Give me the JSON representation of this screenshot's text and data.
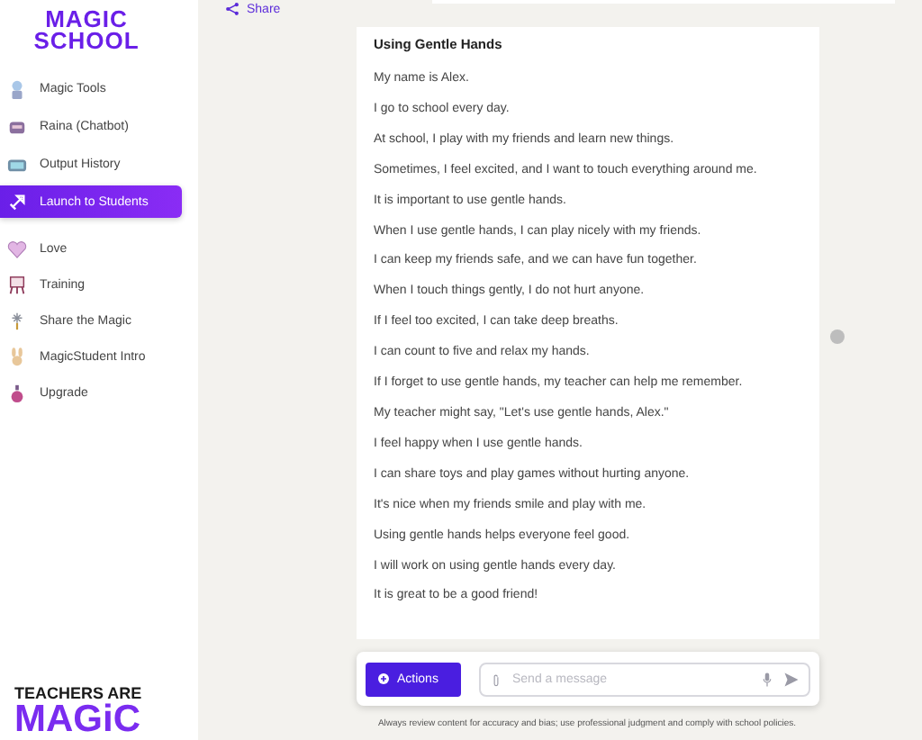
{
  "sidebar": {
    "logo": [
      "MAGIC",
      "SCHOOL"
    ],
    "items": [
      {
        "label": "Magic Tools",
        "selected": false
      },
      {
        "label": "Raina (Chatbot)",
        "selected": false
      },
      {
        "label": "Output History",
        "selected": false
      },
      {
        "label": "Launch to Students",
        "selected": true
      }
    ],
    "extra_items": [
      {
        "label": "Love"
      },
      {
        "label": "Training"
      },
      {
        "label": "Share the Magic"
      },
      {
        "label": "MagicStudent Intro"
      },
      {
        "label": "Upgrade"
      }
    ],
    "banner": [
      "TEACHERS ARE",
      "MAGiC"
    ]
  },
  "share_link": "Share",
  "output": {
    "title": "Using Gentle Hands",
    "lines": [
      "My name is Alex.",
      "I go to school every day.",
      "At school, I play with my friends and learn new things.",
      "Sometimes, I feel excited, and I want to touch everything around me.",
      "It is important to use gentle hands.",
      "When I use gentle hands, I can play nicely with my friends.",
      "I can keep my friends safe, and we can have fun together.",
      "When I touch things gently, I do not hurt anyone.",
      "If I feel too excited, I can take deep breaths.",
      "I can count to five and relax my hands.",
      "If I forget to use gentle hands, my teacher can help me remember.",
      "My teacher might say, \"Let's use gentle hands, Alex.\"",
      "I feel happy when I use gentle hands.",
      "I can share toys and play games without hurting anyone.",
      "It's nice when my friends smile and play with me.",
      "Using gentle hands helps everyone feel good.",
      "I will work on using gentle hands every day.",
      "It is great to be a good friend!"
    ]
  },
  "composer": {
    "actions_button": "Actions",
    "placeholder": "Send a message"
  },
  "disclaimer": "Always review content for accuracy and bias; use professional judgment and comply with school policies."
}
